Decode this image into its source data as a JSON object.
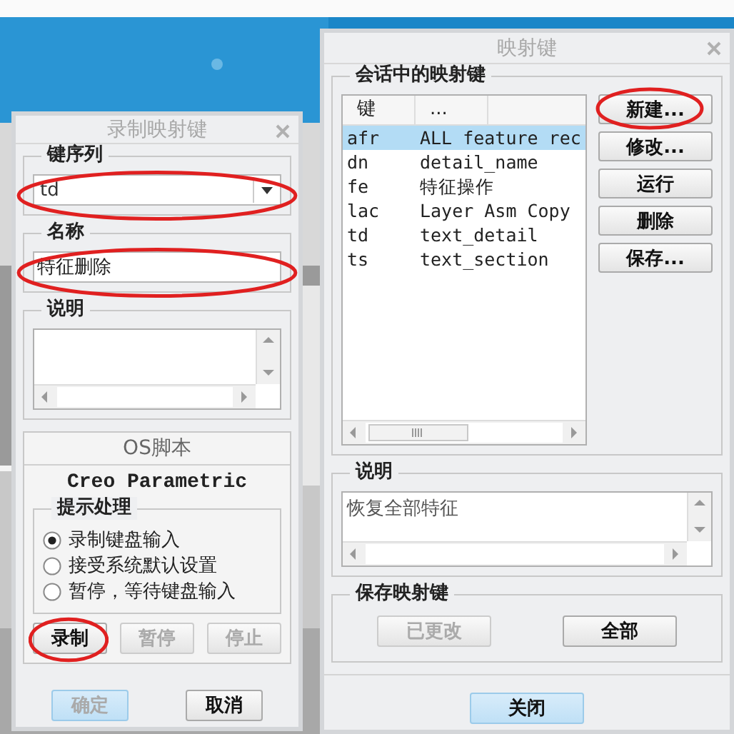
{
  "record_dialog": {
    "title": "录制映射键",
    "key_sequence": {
      "label": "键序列",
      "value": "td",
      "circled": true
    },
    "name": {
      "label": "名称",
      "value": "特征删除",
      "circled": true
    },
    "description": {
      "label": "说明"
    },
    "os_script": {
      "title": "OS脚本",
      "program": "Creo Parametric",
      "prompt_label": "提示处理",
      "options": [
        {
          "label": "录制键盘输入",
          "selected": true
        },
        {
          "label": "接受系统默认设置",
          "selected": false
        },
        {
          "label": "暂停，等待键盘输入",
          "selected": false
        }
      ],
      "buttons": [
        {
          "label": "录制",
          "disabled": false,
          "circled": true
        },
        {
          "label": "暂停",
          "disabled": true,
          "circled": false
        },
        {
          "label": "停止",
          "disabled": true,
          "circled": false
        }
      ]
    },
    "footer_buttons": [
      {
        "label": "确定",
        "default": true,
        "disabled": true
      },
      {
        "label": "取消",
        "default": false,
        "disabled": false
      }
    ]
  },
  "mapkeys_dialog": {
    "title": "映射键",
    "group_label": "会话中的映射键",
    "columns": [
      "键",
      "..."
    ],
    "rows": [
      {
        "key": "afr",
        "name": "ALL feature rec",
        "selected": true
      },
      {
        "key": "dn",
        "name": "detail_name",
        "selected": false
      },
      {
        "key": "fe",
        "name": "特征操作",
        "selected": false
      },
      {
        "key": "lac",
        "name": "Layer Asm Copy",
        "selected": false
      },
      {
        "key": "td",
        "name": "text_detail",
        "selected": false
      },
      {
        "key": "ts",
        "name": "text_section",
        "selected": false
      }
    ],
    "side_buttons": [
      {
        "label": "新建...",
        "circled": true
      },
      {
        "label": "修改...",
        "circled": false
      },
      {
        "label": "运行",
        "circled": false
      },
      {
        "label": "删除",
        "circled": false
      },
      {
        "label": "保存...",
        "circled": false
      }
    ],
    "description": {
      "label": "说明",
      "value": "恢复全部特征"
    },
    "save_group": {
      "label": "保存映射键",
      "buttons": [
        {
          "label": "已更改",
          "disabled": true
        },
        {
          "label": "全部",
          "disabled": false
        }
      ]
    },
    "close_button": {
      "label": "关闭",
      "default": true,
      "disabled": false
    }
  }
}
